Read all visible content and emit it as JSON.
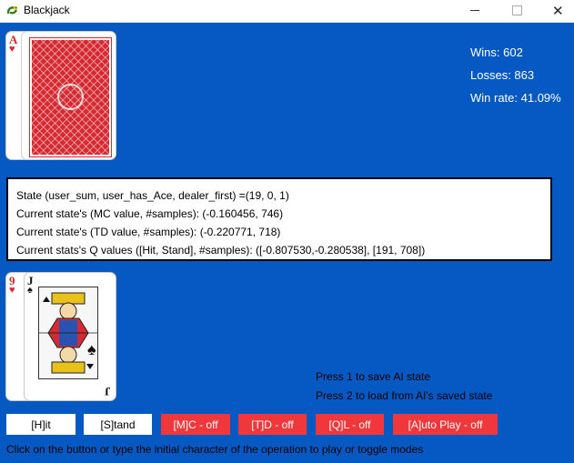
{
  "window": {
    "title": "Blackjack",
    "close_glyph": "✕"
  },
  "dealer": {
    "up_card": {
      "rank": "A",
      "suit": "♥"
    }
  },
  "stats": {
    "wins": "Wins: 602",
    "losses": "Losses: 863",
    "win_rate": "Win rate: 41.09%"
  },
  "info": {
    "state": "State (user_sum, user_has_Ace, dealer_first) =(19, 0, 1)",
    "mc": "Current state's (MC value, #samples): (-0.160456, 746)",
    "td": "Current state's (TD value, #samples): (-0.220771, 718)",
    "q": "Current stats's Q values ([Hit, Stand], #samples): ([-0.807530,-0.280538], [191, 708])"
  },
  "player": {
    "cards": [
      {
        "rank": "9",
        "suit": "♥"
      },
      {
        "rank": "J",
        "suit": "♠"
      }
    ]
  },
  "hints": {
    "save": "Press 1 to save AI state",
    "load": "Press 2 to load from AI's saved state"
  },
  "buttons": {
    "hit": "[H]it",
    "stand": "[S]tand",
    "mc": "[M]C - off",
    "td": "[T]D - off",
    "ql": "[Q]L - off",
    "auto": "[A]uto Play - off"
  },
  "footer": "Click on the button or type the initial character of the operation to play or toggle modes",
  "colors": {
    "table_bg": "#0659c2",
    "off_button": "#f0373c",
    "card_back": "#d62a33"
  }
}
